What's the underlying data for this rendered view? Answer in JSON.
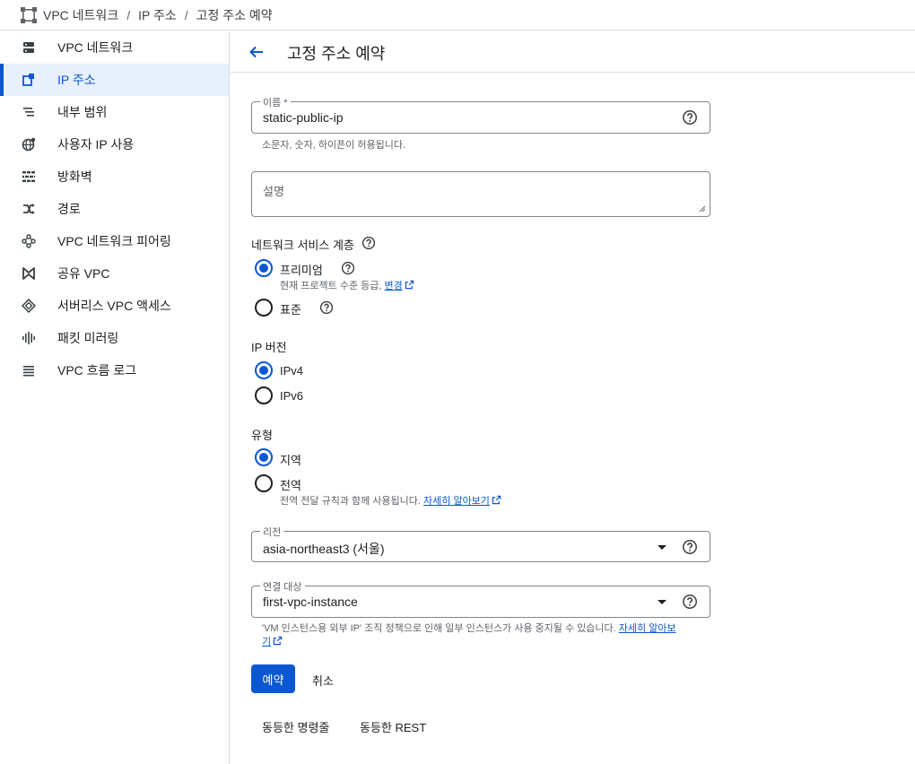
{
  "breadcrumb": [
    "VPC 네트워크",
    "IP 주소",
    "고정 주소 예약"
  ],
  "breadcrumb_sep": "/",
  "sidebar": {
    "items": [
      {
        "label": "VPC 네트워크",
        "icon": "vpc-network-icon",
        "active": false
      },
      {
        "label": "IP 주소",
        "icon": "ip-address-icon",
        "active": true
      },
      {
        "label": "내부 범위",
        "icon": "internal-range-icon",
        "active": false
      },
      {
        "label": "사용자 IP 사용",
        "icon": "globe-icon",
        "active": false
      },
      {
        "label": "방화벽",
        "icon": "firewall-icon",
        "active": false
      },
      {
        "label": "경로",
        "icon": "routes-icon",
        "active": false
      },
      {
        "label": "VPC 네트워크 피어링",
        "icon": "peering-icon",
        "active": false
      },
      {
        "label": "공유 VPC",
        "icon": "shared-vpc-icon",
        "active": false
      },
      {
        "label": "서버리스 VPC 액세스",
        "icon": "serverless-icon",
        "active": false
      },
      {
        "label": "패킷 미러링",
        "icon": "packet-mirroring-icon",
        "active": false
      },
      {
        "label": "VPC 흐름 로그",
        "icon": "flow-logs-icon",
        "active": false
      }
    ]
  },
  "page": {
    "title": "고정 주소 예약"
  },
  "form": {
    "name": {
      "label": "이름 *",
      "value": "static-public-ip",
      "hint": "소문자, 숫자, 하이픈이 허용됩니다."
    },
    "description": {
      "placeholder": "설명"
    },
    "tier": {
      "label": "네트워크 서비스 계층",
      "premium": {
        "label": "프리미엄",
        "hint_prefix": "현재 프로젝트 수준 등급, ",
        "hint_link": "변경",
        "selected": true
      },
      "standard": {
        "label": "표준",
        "selected": false
      }
    },
    "ip_version": {
      "label": "IP 버전",
      "ipv4": {
        "label": "IPv4",
        "selected": true
      },
      "ipv6": {
        "label": "IPv6",
        "selected": false
      }
    },
    "type": {
      "label": "유형",
      "regional": {
        "label": "지역",
        "selected": true
      },
      "global": {
        "label": "전역",
        "hint_prefix": "전역 전달 규칙과 함께 사용됩니다. ",
        "hint_link": "자세히 알아보기",
        "selected": false
      }
    },
    "region": {
      "label": "리전",
      "value": "asia-northeast3 (서울)"
    },
    "attach": {
      "label": "연결 대상",
      "value": "first-vpc-instance",
      "hint_prefix": "'VM 인스턴스용 외부 IP' 조직 정책으로 인해 일부 인스턴스가 사용 중지될 수 있습니다. ",
      "hint_link_1": "자세히 알아보",
      "hint_link_2": "기"
    }
  },
  "actions": {
    "reserve": "예약",
    "cancel": "취소",
    "equiv_cli": "동등한 명령줄",
    "equiv_rest": "동등한 REST"
  },
  "colors": {
    "accent": "#0b57d0",
    "active_bg": "#e8f0fe",
    "border": "#dadce0"
  }
}
